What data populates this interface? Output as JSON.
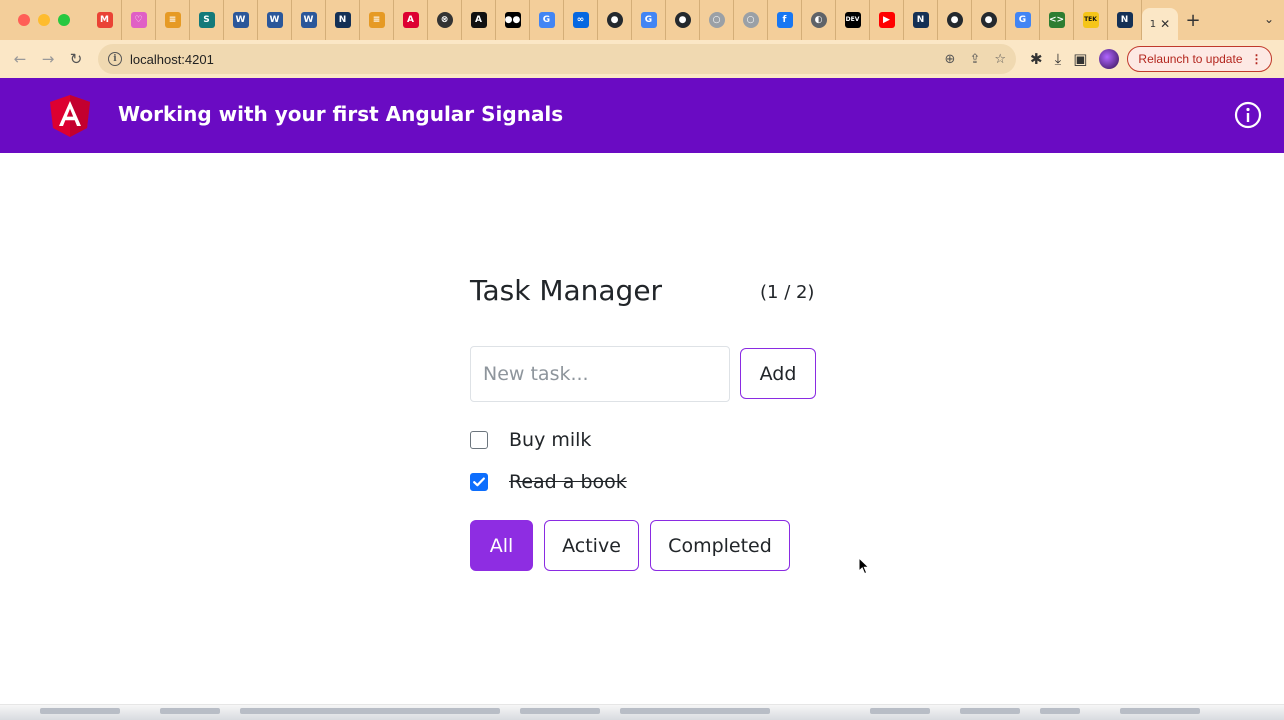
{
  "browser": {
    "tabs": [
      {
        "icon": "gmail-icon",
        "glyph": "M",
        "color": "#ea4335"
      },
      {
        "icon": "heart-icon",
        "glyph": "♡",
        "color": "#e05fc5"
      },
      {
        "icon": "doc-icon",
        "glyph": "≡",
        "color": "#e69a24"
      },
      {
        "icon": "sharepoint-icon",
        "glyph": "S",
        "color": "#137a7a"
      },
      {
        "icon": "word-icon",
        "glyph": "W",
        "color": "#2b579a"
      },
      {
        "icon": "word-icon",
        "glyph": "W",
        "color": "#2b579a"
      },
      {
        "icon": "word-icon",
        "glyph": "W",
        "color": "#2b579a"
      },
      {
        "icon": "nx-icon",
        "glyph": "N",
        "color": "#143055"
      },
      {
        "icon": "doc-icon",
        "glyph": "≡",
        "color": "#e69a24"
      },
      {
        "icon": "angular-icon",
        "glyph": "A",
        "color": "#dd0031"
      },
      {
        "icon": "x-circle-icon",
        "glyph": "⊗",
        "color": "#333333"
      },
      {
        "icon": "ai-icon",
        "glyph": "A",
        "color": "#111111"
      },
      {
        "icon": "medium-icon",
        "glyph": "●●",
        "color": "#000000"
      },
      {
        "icon": "google-icon",
        "glyph": "G",
        "color": "#4285f4"
      },
      {
        "icon": "meta-icon",
        "glyph": "∞",
        "color": "#0668e1"
      },
      {
        "icon": "github-icon",
        "glyph": "●",
        "color": "#24292e"
      },
      {
        "icon": "google-icon",
        "glyph": "G",
        "color": "#4285f4"
      },
      {
        "icon": "github-icon",
        "glyph": "●",
        "color": "#24292e"
      },
      {
        "icon": "globe-icon",
        "glyph": "○",
        "color": "#9aa0a6"
      },
      {
        "icon": "globe-icon",
        "glyph": "○",
        "color": "#9aa0a6"
      },
      {
        "icon": "facebook-icon",
        "glyph": "f",
        "color": "#1877f2"
      },
      {
        "icon": "globe-icon",
        "glyph": "◐",
        "color": "#5f6368"
      },
      {
        "icon": "dev-icon",
        "glyph": "DEV",
        "color": "#000000"
      },
      {
        "icon": "youtube-icon",
        "glyph": "▶",
        "color": "#ff0000"
      },
      {
        "icon": "nx-icon",
        "glyph": "N",
        "color": "#143055"
      },
      {
        "icon": "github-icon",
        "glyph": "●",
        "color": "#24292e"
      },
      {
        "icon": "github-icon",
        "glyph": "●",
        "color": "#24292e"
      },
      {
        "icon": "google-icon",
        "glyph": "G",
        "color": "#4285f4"
      },
      {
        "icon": "code-icon",
        "glyph": "<>",
        "color": "#2e7d32"
      },
      {
        "icon": "tek-icon",
        "glyph": "TEK",
        "color": "#f5c518"
      },
      {
        "icon": "nx-icon",
        "glyph": "N",
        "color": "#143055"
      }
    ],
    "active_tab_text": "1",
    "url": "localhost:4201",
    "relaunch_label": "Relaunch to update"
  },
  "app": {
    "title": "Working with your first Angular Signals",
    "brand_color": "#6a0bc3",
    "logo_color": "#dd0031"
  },
  "task_manager": {
    "title": "Task Manager",
    "count": "(1 / 2)",
    "input_placeholder": "New task...",
    "add_label": "Add",
    "accent_color": "#8e2de2",
    "tasks": [
      {
        "label": "Buy milk",
        "completed": false
      },
      {
        "label": "Read a book",
        "completed": true
      }
    ],
    "filters": {
      "all": "All",
      "active": "Active",
      "completed": "Completed",
      "selected": "All"
    }
  }
}
